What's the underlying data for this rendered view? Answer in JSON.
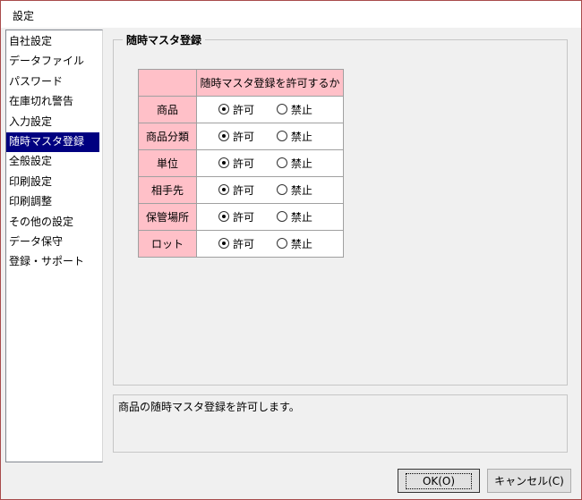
{
  "window": {
    "title": "設定"
  },
  "sidebar": {
    "items": [
      {
        "label": "自社設定"
      },
      {
        "label": "データファイル"
      },
      {
        "label": "パスワード"
      },
      {
        "label": "在庫切れ警告"
      },
      {
        "label": "入力設定"
      },
      {
        "label": "随時マスタ登録"
      },
      {
        "label": "全般設定"
      },
      {
        "label": "印刷設定"
      },
      {
        "label": "印刷調整"
      },
      {
        "label": "その他の設定"
      },
      {
        "label": "データ保守"
      },
      {
        "label": "登録・サポート"
      }
    ],
    "selected_index": 5
  },
  "group": {
    "title": "随時マスタ登録",
    "column_header": "随時マスタ登録を許可するか",
    "allow_label": "許可",
    "deny_label": "禁止",
    "rows": [
      {
        "label": "商品",
        "value": "allow"
      },
      {
        "label": "商品分類",
        "value": "allow"
      },
      {
        "label": "単位",
        "value": "allow"
      },
      {
        "label": "相手先",
        "value": "allow"
      },
      {
        "label": "保管場所",
        "value": "allow"
      },
      {
        "label": "ロット",
        "value": "allow"
      }
    ]
  },
  "description": "商品の随時マスタ登録を許可します。",
  "buttons": {
    "ok": "OK(O)",
    "cancel": "キャンセル(C)"
  },
  "colors": {
    "header_bg": "#ffc0c8",
    "selected_bg": "#000080"
  }
}
